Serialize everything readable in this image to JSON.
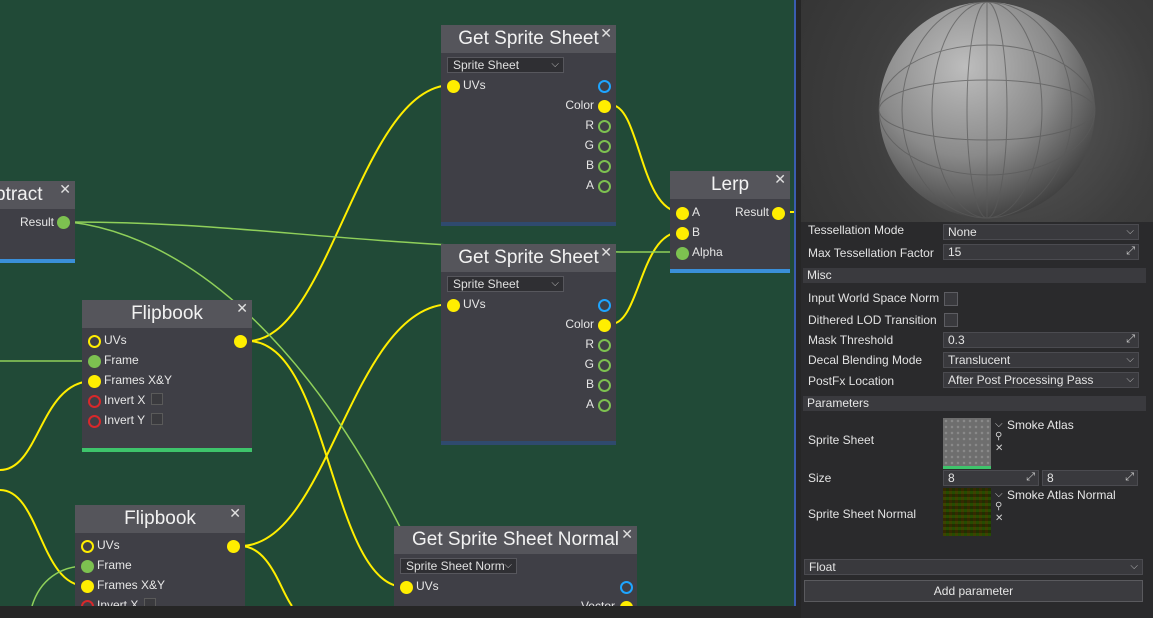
{
  "graph": {
    "subtract_node": {
      "title": "Subtract",
      "title_visible": "btract",
      "result_label": "Result"
    },
    "get_sprite_sheet_1": {
      "title": "Get Sprite Sheet",
      "mode": "Sprite Sheet",
      "uvs": "UVs",
      "color": "Color",
      "r": "R",
      "g": "G",
      "b": "B",
      "a": "A"
    },
    "get_sprite_sheet_2": {
      "title": "Get Sprite Sheet",
      "mode": "Sprite Sheet",
      "uvs": "UVs",
      "color": "Color",
      "r": "R",
      "g": "G",
      "b": "B",
      "a": "A"
    },
    "lerp": {
      "title": "Lerp",
      "a": "A",
      "b": "B",
      "alpha": "Alpha",
      "result": "Result"
    },
    "flipbook_1": {
      "title": "Flipbook",
      "uvs": "UVs",
      "frame": "Frame",
      "frames_xy": "Frames X&Y",
      "invert_x": "Invert X",
      "invert_y": "Invert Y"
    },
    "flipbook_2": {
      "title": "Flipbook",
      "uvs": "UVs",
      "frame": "Frame",
      "frames_xy": "Frames X&Y",
      "invert_x": "Invert X"
    },
    "get_sprite_sheet_normal": {
      "title": "Get Sprite Sheet Normal",
      "mode": "Sprite Sheet Norm",
      "uvs": "UVs",
      "vector": "Vector"
    },
    "close_glyph": "✕"
  },
  "colors": {
    "canvas": "#214a37",
    "node": "#3f3f46",
    "node_title": "#55555b",
    "wire_yellow": "#ffee00",
    "wire_green": "#8fd05a",
    "accent_blue": "#3a8fd8",
    "accent_green": "#3ec46b"
  },
  "properties": {
    "tessellation_mode": {
      "label": "Tessellation Mode",
      "value": "None"
    },
    "max_tessellation_factor": {
      "label": "Max Tessellation Factor",
      "value": "15"
    },
    "misc_section": "Misc",
    "input_world_space_normal": {
      "label": "Input World Space Norm",
      "checked": false
    },
    "dithered_lod_transition": {
      "label": "Dithered LOD Transition",
      "checked": false
    },
    "mask_threshold": {
      "label": "Mask Threshold",
      "value": "0.3"
    },
    "decal_blending_mode": {
      "label": "Decal Blending Mode",
      "value": "Translucent"
    },
    "postfx_location": {
      "label": "PostFx Location",
      "value": "After Post Processing Pass"
    },
    "parameters_section": "Parameters",
    "sprite_sheet": {
      "label": "Sprite Sheet",
      "asset": "Smoke Atlas"
    },
    "size": {
      "label": "Size",
      "x": "8",
      "y": "8"
    },
    "sprite_sheet_normal": {
      "label": "Sprite Sheet Normal",
      "asset": "Smoke Atlas Normal"
    },
    "new_param_type": "Float",
    "add_parameter": "Add parameter"
  },
  "icons": {
    "chevron": "chevron-down-icon",
    "resize": "resize-icon",
    "search": "search-icon",
    "clear": "clear-icon",
    "close": "close-icon"
  }
}
